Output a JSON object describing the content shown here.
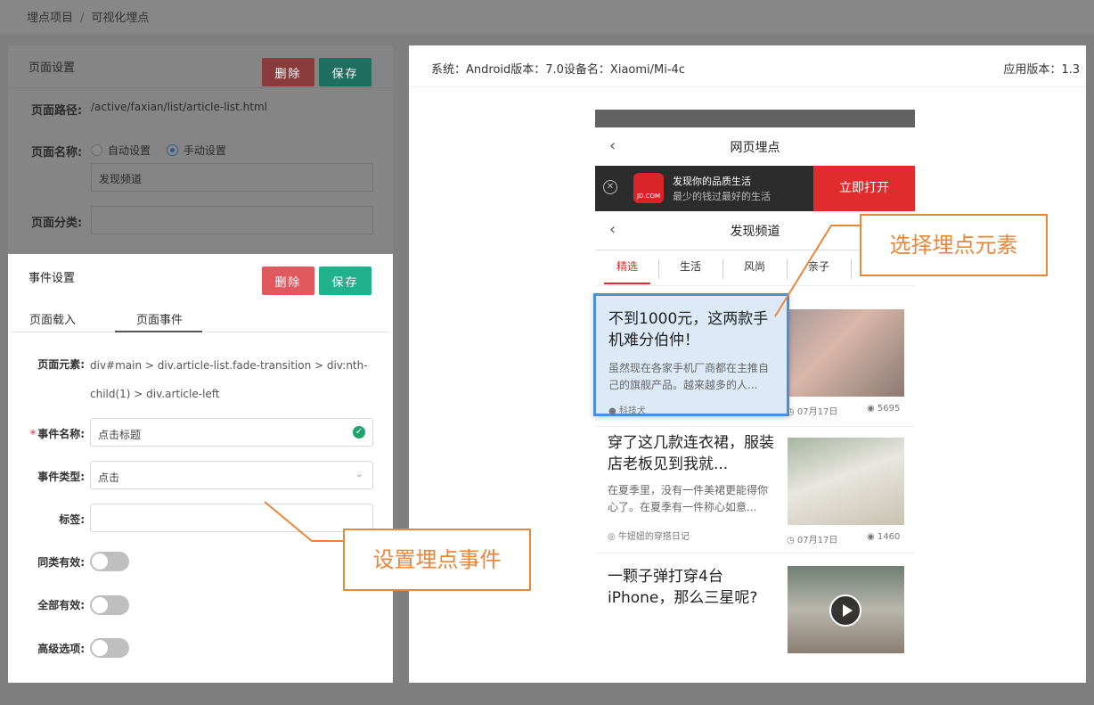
{
  "breadcrumb": {
    "root": "埋点项目",
    "separator": "/",
    "current": "可视化埋点"
  },
  "page_settings": {
    "title": "页面设置",
    "delete_label": "删除",
    "save_label": "保存",
    "path_label": "页面路径:",
    "path_value": "/active/faxian/list/article-list.html",
    "name_label": "页面名称:",
    "name_option_auto": "自动设置",
    "name_option_manual": "手动设置",
    "name_value": "发现频道",
    "category_label": "页面分类:",
    "category_value": ""
  },
  "event_settings": {
    "title": "事件设置",
    "delete_label": "删除",
    "save_label": "保存",
    "tabs": [
      {
        "label": "页面载入"
      },
      {
        "label": "页面事件"
      }
    ],
    "element_label": "页面元素:",
    "element_value": "div#main > div.article-list.fade-transition > div:nth-child(1) > div.article-left",
    "event_name_label": "事件名称:",
    "event_name_value": "点击标题",
    "event_type_label": "事件类型:",
    "event_type_value": "点击",
    "tag_label": "标签:",
    "tag_value": "",
    "same_type_label": "同类有效:",
    "all_valid_label": "全部有效:",
    "advanced_label": "高级选项:"
  },
  "device": {
    "info": "系统：Android版本：7.0设备名：Xiaomi/Mi-4c",
    "app_version": "应用版本：1.3"
  },
  "phone": {
    "webview_title": "网页埋点",
    "banner_title": "发现你的品质生活",
    "banner_subtitle": "最少的钱过最好的生活",
    "banner_logo_text": "JD.COM",
    "open_button": "立即打开",
    "channel_title": "发现频道",
    "categories": [
      {
        "label": "精选"
      },
      {
        "label": "生活"
      },
      {
        "label": "风尚"
      },
      {
        "label": "亲子"
      }
    ],
    "articles": [
      {
        "title": "不到1000元，这两款手机难分伯仲！",
        "desc": "虽然现在各家手机厂商都在主推自己的旗舰产品。越来越多的人...",
        "source": "科技犬",
        "date": "07月17日",
        "views": "5695"
      },
      {
        "title": "穿了这几款连衣裙，服装店老板见到我就...",
        "desc": "在夏季里，没有一件美裙更能得你心了。在夏季有一件称心如意...",
        "source": "牛妞妞的穿搭日记",
        "date": "07月17日",
        "views": "1460"
      },
      {
        "title": "一颗子弹打穿4台iPhone，那么三星呢?",
        "desc": "",
        "source": "",
        "date": "",
        "views": ""
      }
    ]
  },
  "callouts": {
    "select_element": "选择埋点元素",
    "set_event": "设置埋点事件"
  },
  "colors": {
    "delete": "#e0595e",
    "save": "#1fb28d",
    "callout": "#e8863a",
    "highlight_border": "#4a90d9",
    "open_button": "#e02c2c"
  }
}
